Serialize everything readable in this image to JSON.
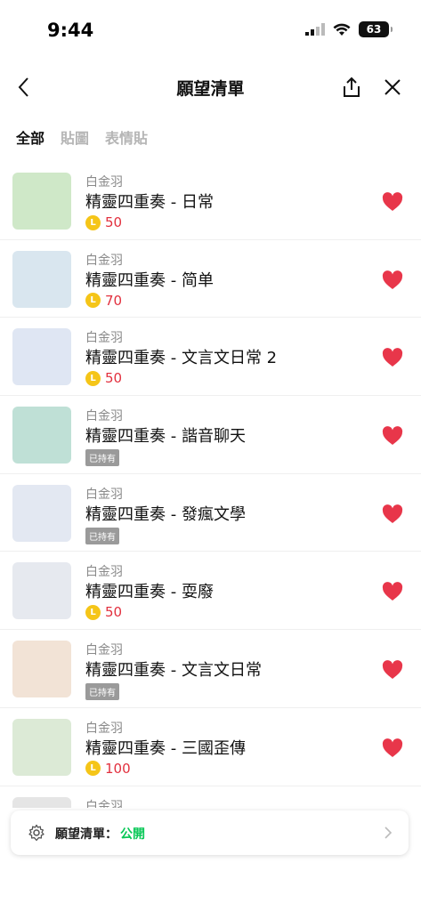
{
  "status": {
    "time": "9:44",
    "battery": "63"
  },
  "nav": {
    "title": "願望清單"
  },
  "tabs": [
    {
      "label": "全部",
      "active": true
    },
    {
      "label": "貼圖",
      "active": false
    },
    {
      "label": "表情貼",
      "active": false
    }
  ],
  "items": [
    {
      "author": "白金羽",
      "title": "精靈四重奏 - 日常",
      "price": "50",
      "owned": false,
      "thumb_color": "#cfe8c8"
    },
    {
      "author": "白金羽",
      "title": "精靈四重奏 - 简单",
      "price": "70",
      "owned": false,
      "thumb_color": "#d9e6ef"
    },
    {
      "author": "白金羽",
      "title": "精靈四重奏 - 文言文日常 2",
      "price": "50",
      "owned": false,
      "thumb_color": "#dfe6f3"
    },
    {
      "author": "白金羽",
      "title": "精靈四重奏 - 諧音聊天",
      "price": "",
      "owned": true,
      "owned_label": "已持有",
      "thumb_color": "#bfe0d6"
    },
    {
      "author": "白金羽",
      "title": "精靈四重奏 - 發瘋文學",
      "price": "",
      "owned": true,
      "owned_label": "已持有",
      "thumb_color": "#e3e8f2"
    },
    {
      "author": "白金羽",
      "title": "精靈四重奏 - 耍廢",
      "price": "50",
      "owned": false,
      "thumb_color": "#e6e9ef"
    },
    {
      "author": "白金羽",
      "title": "精靈四重奏 - 文言文日常",
      "price": "",
      "owned": true,
      "owned_label": "已持有",
      "thumb_color": "#f2e3d6"
    },
    {
      "author": "白金羽",
      "title": "精靈四重奏 - 三國歪傳",
      "price": "100",
      "owned": false,
      "thumb_color": "#dcead6"
    },
    {
      "author": "白金羽",
      "title": "",
      "price": "",
      "owned": false,
      "thumb_color": "#e5e5e5"
    }
  ],
  "wishlist": {
    "label": "願望清單：",
    "value": "公開"
  },
  "colors": {
    "accent": "#06c755",
    "heart": "#e8364a",
    "price": "#e2303e",
    "coin": "#f5c518"
  }
}
